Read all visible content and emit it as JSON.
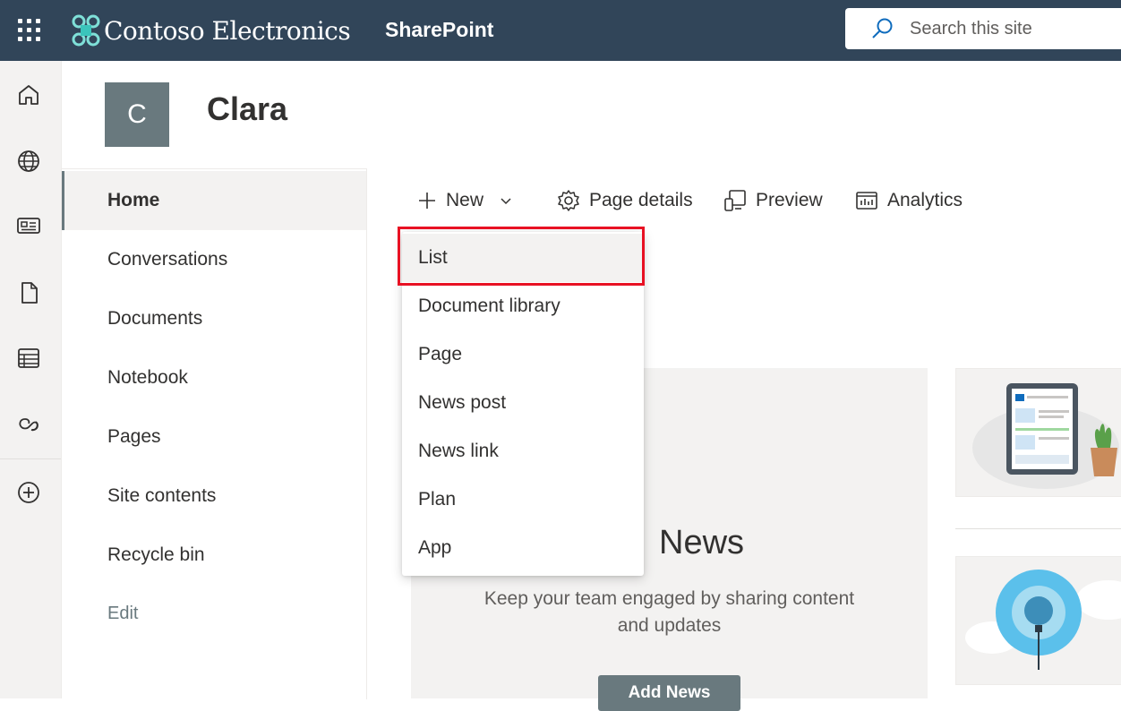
{
  "suite_bar": {
    "brand": "Contoso Electronics",
    "app": "SharePoint",
    "search_placeholder": "Search this site"
  },
  "app_bar": {
    "icons": [
      "home-icon",
      "globe-icon",
      "news-icon",
      "document-icon",
      "list-icon",
      "loop-icon",
      "add-icon"
    ]
  },
  "site": {
    "logo_letter": "C",
    "title": "Clara"
  },
  "left_nav": {
    "items": [
      {
        "label": "Home",
        "active": true
      },
      {
        "label": "Conversations"
      },
      {
        "label": "Documents"
      },
      {
        "label": "Notebook"
      },
      {
        "label": "Pages"
      },
      {
        "label": "Site contents"
      },
      {
        "label": "Recycle bin"
      }
    ],
    "edit": "Edit"
  },
  "command_bar": {
    "new": "New",
    "page_details": "Page details",
    "preview": "Preview",
    "analytics": "Analytics"
  },
  "new_menu": {
    "items": [
      "List",
      "Document library",
      "Page",
      "News post",
      "News link",
      "Plan",
      "App"
    ],
    "highlighted": "List"
  },
  "news": {
    "title": "News",
    "description": "Keep your team engaged by sharing content and updates",
    "button": "Add News"
  },
  "colors": {
    "suite_bar": "#314559",
    "accent": "#69797e",
    "highlight": "#e81123"
  }
}
